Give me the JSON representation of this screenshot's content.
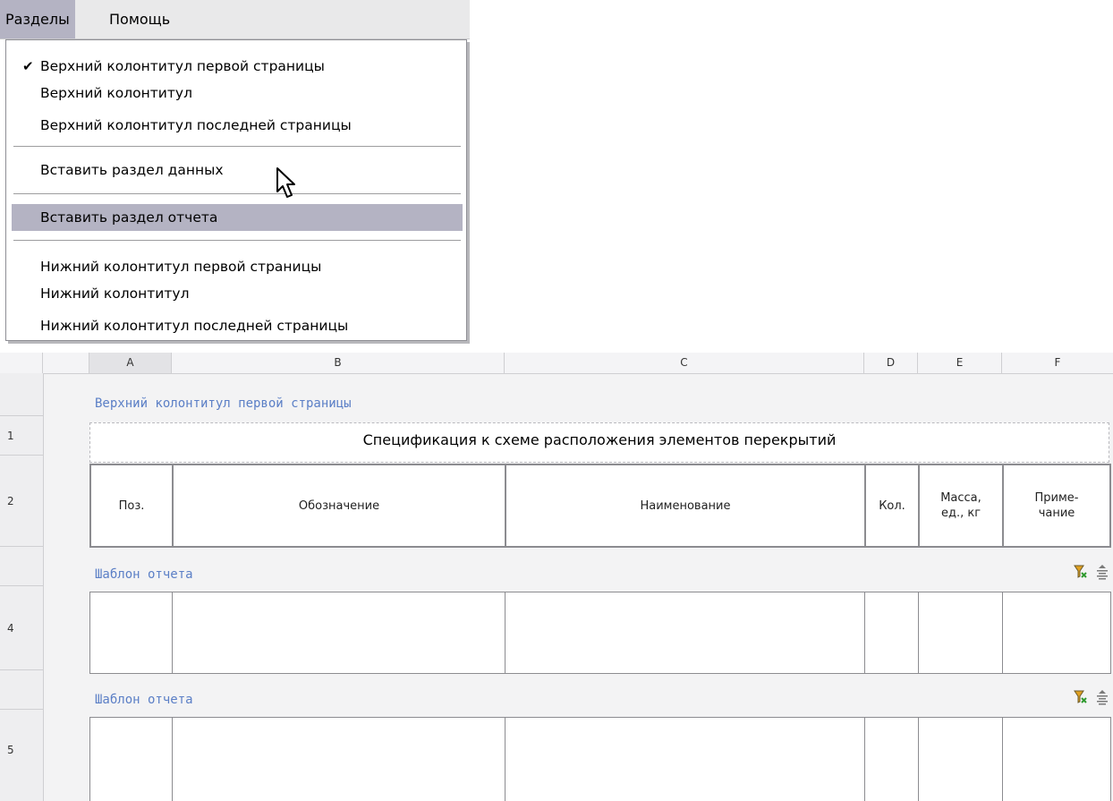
{
  "menubar": {
    "items": [
      {
        "label": "Разделы",
        "active": true
      },
      {
        "label": "Помощь",
        "active": false
      }
    ]
  },
  "dropdown": {
    "items": [
      {
        "label": "Верхний колонтитул первой страницы",
        "checked": true
      },
      {
        "label": "Верхний колонтитул"
      },
      {
        "label": "Верхний колонтитул последней страницы"
      },
      {
        "label": "Вставить раздел данных"
      },
      {
        "label": "Вставить раздел отчета",
        "hover": true
      },
      {
        "label": "Нижний колонтитул первой страницы"
      },
      {
        "label": "Нижний колонтитул"
      },
      {
        "label": "Нижний колонтитул последней страницы"
      }
    ]
  },
  "grid": {
    "columns": [
      "A",
      "B",
      "C",
      "D",
      "E",
      "F"
    ],
    "rows": [
      "1",
      "2",
      "4",
      "5"
    ],
    "header_section_title": "Верхний колонтитул первой страницы",
    "title_cell": "Спецификация к схеме расположения элементов перекрытий",
    "table_headers": [
      "Поз.",
      "Обозначение",
      "Наименование",
      "Кол.",
      "Масса,\nед., кг",
      "Приме-\nчание"
    ],
    "report_sections": [
      {
        "title": "Шаблон отчета"
      },
      {
        "title": "Шаблон отчета"
      }
    ]
  },
  "colors": {
    "section_title": "#5b7fc6",
    "menu_highlight": "#b4b3c3",
    "filter_icon": "#e0a020"
  }
}
